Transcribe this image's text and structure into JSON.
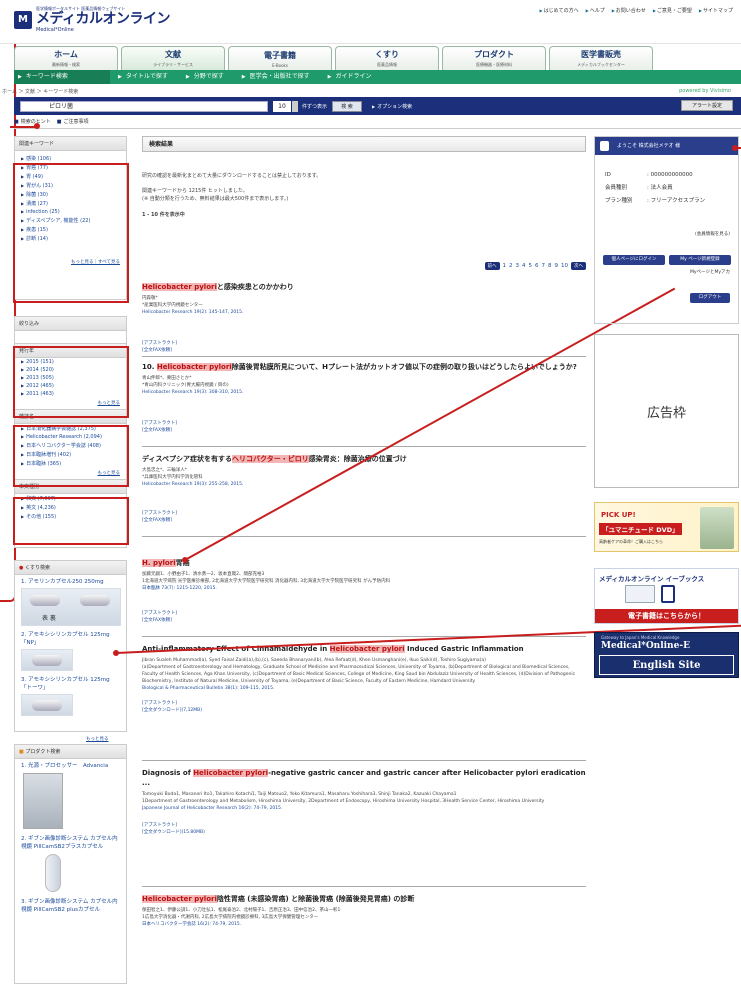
{
  "header": {
    "logo_small": "医学情報ポータルサイト 医薬品情報ウェブサイト",
    "logo_main": "メディカルオンライン",
    "logo_sub": "Medical*Online",
    "top_links": [
      "はじめての方へ",
      "ヘルプ",
      "お問い合わせ",
      "ご意見・ご要望",
      "サイトマップ"
    ]
  },
  "tabs": [
    {
      "title": "ホーム",
      "sub": "最新情報・検索"
    },
    {
      "title": "文献",
      "sub": "ライブラリ・サービス"
    },
    {
      "title": "電子書籍",
      "sub": "E-Books"
    },
    {
      "title": "くすり",
      "sub": "医薬品情報"
    },
    {
      "title": "プロダクト",
      "sub": "医療機器・医療材料"
    },
    {
      "title": "医学書販売",
      "sub": "メディカルブックセンター"
    }
  ],
  "subnav": [
    "キーワード検索",
    "タイトルで探す",
    "分野で探す",
    "医学会・出版社で探す",
    "ガイドライン"
  ],
  "breadcrumb": "ホーム ＞ 文献 ＞ キーワード検索",
  "breadcrumb_right": "powered by Vivisimo",
  "search": {
    "query": "ピロリ菌",
    "per_page": "10",
    "per_page_label": "件ずつ表示",
    "button": "検 索",
    "option": "オプション検索",
    "alert": "アラート設定"
  },
  "hints": [
    "検索のヒント",
    "ご注意事項"
  ],
  "related": {
    "heading": "関連キーワード",
    "items": [
      "感染 (106)",
      "胃癌 (77)",
      "胃 (49)",
      "胃がん (31)",
      "除菌 (30)",
      "潰瘍 (27)",
      "infection (25)",
      "ディスペプシア, 機能性 (22)",
      "疾患 (15)",
      "診断 (14)"
    ],
    "more": "もっと見る｜すべて見る"
  },
  "narrow": {
    "heading": "絞り込み",
    "year_heading": "発行年",
    "years": [
      "2015 (151)",
      "2014 (520)",
      "2013 (505)",
      "2012 (465)",
      "2011 (463)"
    ],
    "journal_heading": "雑誌名",
    "journals": [
      "日本消化器病学会雑誌 (2,375)",
      "Helicobacter Research (2,094)",
      "日本ヘリコバクター学会誌 (408)",
      "日本臨牀増刊 (402)",
      "日本臨牀 (365)"
    ],
    "lang_heading": "本文種別",
    "langs": [
      "和文 (7,697)",
      "英文 (4,236)",
      "その他 (155)"
    ],
    "more": "もっと見る"
  },
  "drugs": {
    "heading": "くすり検索",
    "items": [
      {
        "name": "1. アモリンカプセル250 250mg",
        "label": "表 裏"
      },
      {
        "name": "2. アモキシシリンカプセル 125mg「NP」",
        "label": ""
      },
      {
        "name": "3. アモキシシリンカプセル 125mg「トーワ」",
        "label": ""
      }
    ],
    "more": "もっと見る"
  },
  "products": {
    "heading": "プロダクト検索",
    "items": [
      "1. 光源・プロセッサー　Advancia",
      "2. ギブン画像診断システム カプセル内視鏡 PillCamSB2プラスカプセル",
      "3. ギブン画像診断システム カプセル内視鏡 PillCamSB2 plusカプセル"
    ]
  },
  "results": {
    "heading": "検索結果",
    "note": "研究の確認を最新化まとめて大量にダウンロードすることは禁止しております。",
    "summary": "関連キーワードから 1215件 ヒットしました。",
    "summary2": "(※ 自動分類を行うため、無料結果は最大500件まで表示します。)",
    "range": "1 - 10 件を表示中",
    "pages": [
      "前へ",
      "1",
      "2",
      "3",
      "4",
      "5",
      "6",
      "7",
      "8",
      "9",
      "10",
      "次へ"
    ],
    "link_abstract": "[アブストラクト]",
    "link_fax": "[全文FAX依頼]",
    "link_dl": "[全文ダウンロード]",
    "articles": [
      {
        "pre": "",
        "hl": "Helicobacter pylori",
        "post": "と感染疾患とのかかわり",
        "meta": [
          "円森敬*",
          "*産業医科大学内視鏡センター",
          "Helicobacter Research 19(2): 145-147, 2015."
        ],
        "dl": ""
      },
      {
        "pre": "10. ",
        "hl": "Helicobacter pylori",
        "post": "除菌後胃粘膜所見について、Hプレート法がカットオフ値以下の症例の取り扱いはどうしたらよいでしょうか?",
        "meta": [
          "青山伸郎*、栗田さとか*",
          "*青山内科クリニック(胃大腸内視鏡 / 目の)",
          "Helicobacter Research 19(3): 308-310, 2015."
        ],
        "dl": ""
      },
      {
        "pre": "ディスペプシア症状を有する",
        "hl": "ヘリコバクター・ピロリ",
        "post": "感染胃炎：除菌治療の位置づけ",
        "meta": [
          "大島忠之*、三輪洋人*",
          "*兵庫医科大学内科学消化管科",
          "Helicobacter Research 19(3): 255-258, 2015."
        ],
        "dl": ""
      },
      {
        "pre": "",
        "hl": "H. pylori",
        "post": "胃癌",
        "meta": [
          "加藤元嗣1、小野由子1、清水勇一2、坂本直哉2、間部克裕3",
          "1北海道大学病院 光学医療診療部, 2北海道大学大学院医学研究科 消化器内科, 3北海道大学大学院医学研究科 がん予防内科",
          "日本臨牀 73(7): 1215-1220, 2015."
        ],
        "dl": ""
      },
      {
        "pre": "Anti-inflammatory Effect of Cinnamaldehyde in ",
        "hl": "Helicobacter pylori",
        "post": " Induced Gastric Inflammation",
        "meta": [
          "Jibran Sualeh Muhammad(a), Syed Faisal Zaidi(a),(b),(c), Saeeda Bhanaryani(b), Alea Refaat(d), Khen Usmanghani(e), Ikuo Saiki(d), Toshiro Sugiyama(a)",
          "(a)Department of Gastroenterology and Hematology, Graduate School of Medicine and Pharmaceutical Sciences, University of Toyama, (b)Department of Biological and Biomedical Sciences, Faculty of Health Sciences, Aga Khan University, (c)Department of Basic Medical Sciences, College of Medicine, King Saud bin Abdulaziz University of Health Sciences, (d)Division of Pathogenic Biochemistry, Institute of Natural Medicine, University of Toyama, (e)Department of Basic Science, Faculty of Eastern Medicine, Hamdard University",
          "Biological & Pharmaceutical Bulletin 38(1): 109-115, 2015."
        ],
        "dl": "(7,12MB)"
      },
      {
        "pre": "Diagnosis of ",
        "hl": "Helicobacter pylori",
        "post": "-negative gastric cancer and gastric cancer after Helicobacter pylori eradication ...",
        "meta": [
          "Tomoyuki Boda1, Masanori Ito1, Takahiro Kotachi1, Taiji Matsuo2, Yoko Kitamura1, Masaharu Yoshihara3, Shinji Tanaka2, Kazuaki Chayama1",
          "1Department of Gastroenterology and Metabolism, Hiroshima University, 2Department of Endoscopy, Hiroshima University Hospital, 3Health Service Center, Hiroshima University",
          "Japanese Journal of Helicobacter Research 16(2): 74-79, 2015."
        ],
        "dl": "(15.80MB)"
      },
      {
        "pre": "",
        "hl": "Helicobacter pylori",
        "post": "陰性胃癌 (未感染胃癌) と除菌後胃癌 (除菌後発見胃癌) の診断",
        "meta": [
          "保田智之1、伊藤公訓1、小刀壮弘1、松尾泰治2、北村陽子1、吉原正治3、田中信治2、茶山一彰1",
          "1広島大学消化器・代謝内科, 2広島大学病院内視鏡診療科, 3広島大学保健管理センター",
          "日本ヘリコバクター学会誌 16(2): 74-79, 2015."
        ],
        "dl": ""
      }
    ]
  },
  "member": {
    "heading": "ようこそ 株式会社メテオ 様",
    "rows": [
      {
        "k": "ID",
        "v": ": 000000000000"
      },
      {
        "k": "会員種別",
        "v": ": 法人会員"
      },
      {
        "k": "プラン種別",
        "v": ": フリーアクセスプラン"
      }
    ],
    "detail": "(会員情報を見る)",
    "btn_login": "個人ページにログイン",
    "btn_register": "My ページ新規登録",
    "btn_note": "MyページとMyアカ",
    "logout": "ログアウト"
  },
  "ad": "広告枠",
  "banners": {
    "pick_up": "PICK UP!",
    "yumi": "「ユマニチュード DVD」",
    "yumi_sub": "高齢者ケアの革命！ご購入はこちら",
    "ebooks_title": "メディカルオンライン イーブックス",
    "ebooks_sub": "電子書籍はこちらから！",
    "english_small": "Gateway to Japan's Medical Knowledge",
    "english_brand": "Medical*Online-E",
    "english_site": "English Site"
  }
}
